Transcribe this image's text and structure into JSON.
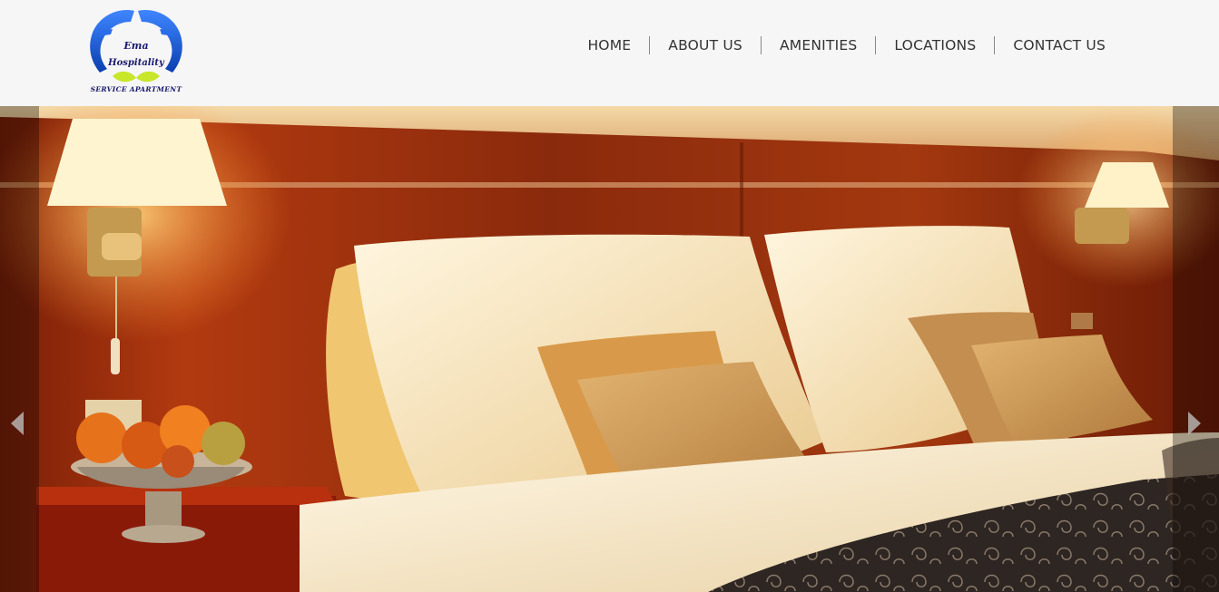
{
  "brand": {
    "name_line1": "Ema",
    "name_line2": "Hospitality",
    "tagline": "SERVICE APARTMENT",
    "colors": {
      "hands_blue": "#1e5fd0",
      "leaf_green": "#c8e62a",
      "text_navy": "#1a1a6e"
    }
  },
  "nav": {
    "items": [
      {
        "label": "HOME"
      },
      {
        "label": "ABOUT US"
      },
      {
        "label": "AMENITIES"
      },
      {
        "label": "LOCATIONS"
      },
      {
        "label": "CONTACT US"
      }
    ]
  },
  "slider": {
    "prev_icon": "chevron-left-icon",
    "next_icon": "chevron-right-icon",
    "image": "hotel bedroom with bedside lamps, pillows and fruit bowl"
  }
}
